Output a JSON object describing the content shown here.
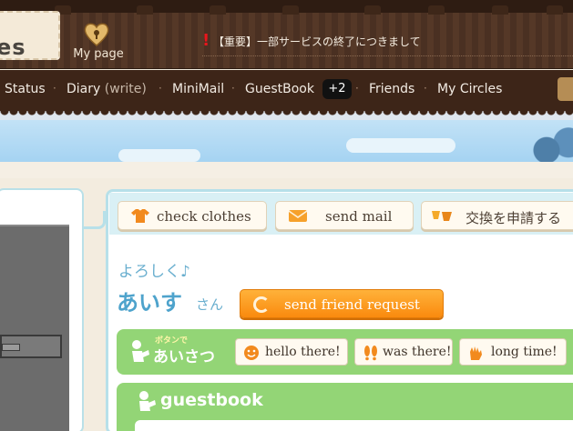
{
  "header": {
    "logo_text": "es",
    "mypage_label": "My page",
    "notice_text": "【重要】一部サービスの終了につきまして",
    "notice_icon": "exclamation-icon",
    "notice_color": "#e8161c"
  },
  "nav": {
    "status": "Status",
    "diary": "Diary",
    "diary_sub": "(write)",
    "minimail": "MiniMail",
    "guestbook": "GuestBook",
    "guestbook_badge": "+2",
    "friends": "Friends",
    "circles": "My Circles",
    "separator": "·"
  },
  "actions": {
    "check_clothes": "check clothes",
    "send_mail": "send mail",
    "exchange": "交換を申請する"
  },
  "profile": {
    "greeting": "よろしく♪",
    "name": "あいす",
    "honorific": "さん",
    "friend_request": "send friend request"
  },
  "greet": {
    "title_small": "ボタンで",
    "title_big": "あいさつ",
    "buttons": [
      "hello there!",
      "was there!",
      "long time!"
    ]
  },
  "guestbook": {
    "title": "guestbook"
  },
  "colors": {
    "brown": "#3d2518",
    "green": "#93d576",
    "orange": "#fa8a0e",
    "teal": "#b7e0e9",
    "blue_text": "#4ea3cc"
  }
}
